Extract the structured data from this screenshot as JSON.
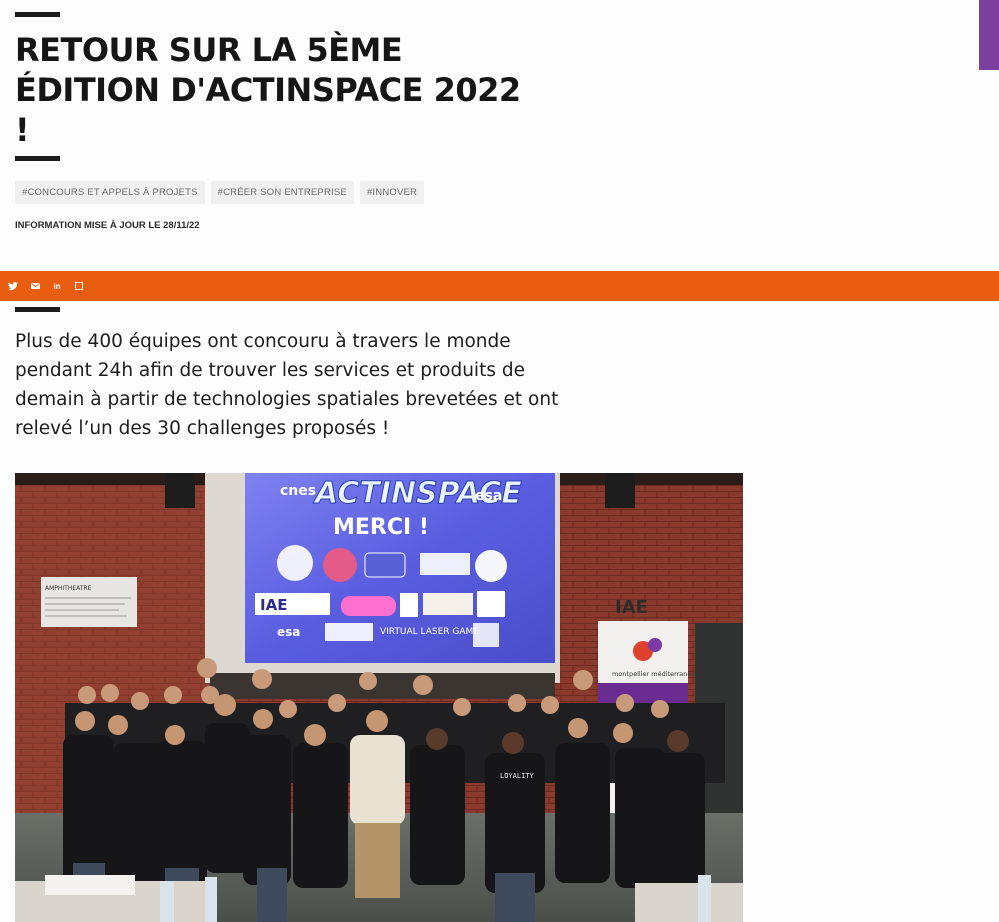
{
  "article": {
    "title": "RETOUR SUR LA 5ÈME ÉDITION D'ACTINSPACE 2022 !",
    "tags": [
      "#CONCOURS ET APPELS À PROJETS",
      "#CRÉER SON ENTREPRISE",
      "#INNOVER"
    ],
    "updated": "INFORMATION MISE À JOUR LE 28/11/22",
    "lead": "Plus de 400 équipes ont concouru à travers le monde pendant 24h afin de trouver les services et produits de demain à partir de technologies spatiales brevetées et ont relevé l’un des 30 challenges proposés !"
  },
  "share": {
    "icons": [
      "twitter-icon",
      "email-icon",
      "linkedin-icon",
      "copy-link-icon"
    ],
    "linkedin_label": "in"
  },
  "photo": {
    "screen_title": "ACTINSPACE",
    "screen_subtitle": "MERCI !",
    "cnes_logo": "cnes",
    "esa_logo": "esa",
    "esa_logo_2": "esa",
    "iae_logo": "IAE",
    "iae_logo_2": "IAE",
    "banner_text": "montpellier méditerranée métropole",
    "virtual_text": "VIRTUAL LASER GAME",
    "door_sign": "AMPHITHEATRE",
    "shirt_text": "LOYALITY"
  },
  "colors": {
    "accent_orange": "#e85d10",
    "accent_purple": "#7b3fa0",
    "text_dark": "#1c1c1c"
  }
}
